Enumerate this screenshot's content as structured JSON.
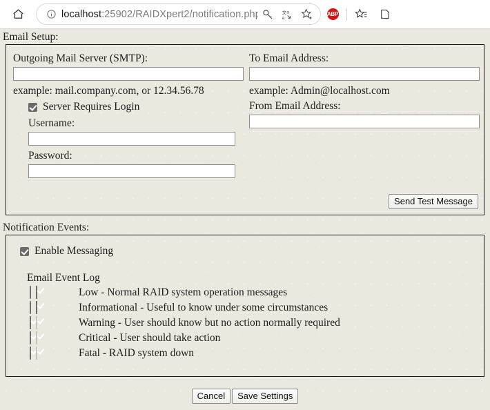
{
  "browser": {
    "home_icon": "home-icon",
    "info_icon": "info-circle-icon",
    "url_host": "localhost",
    "url_path": ":25902/RAIDXpert2/notification.php",
    "search_icon": "search-key-icon",
    "translate_icon": "translate-icon",
    "favorite_icon": "star-add-icon",
    "adblock_label": "ABP",
    "collections_icon": "favorites-list-icon",
    "overflow_icon": "partial-icon"
  },
  "email_setup": {
    "section_label": "Email Setup:",
    "smtp_label": "Outgoing Mail Server (SMTP):",
    "smtp_value": "",
    "smtp_hint": "example: mail.company.com, or 12.34.56.78",
    "requires_login_label": "Server Requires Login",
    "requires_login_checked": true,
    "username_label": "Username:",
    "username_value": "",
    "password_label": "Password:",
    "password_value": "",
    "to_email_label": "To Email Address:",
    "to_email_value": "",
    "to_email_hint": "example: Admin@localhost.com",
    "from_email_label": "From Email Address:",
    "from_email_value": "",
    "send_test_label": "Send Test Message"
  },
  "notification_events": {
    "section_label": "Notification Events:",
    "enable_messaging_label": "Enable Messaging",
    "enable_messaging_checked": true,
    "column_headers": "Email Event Log",
    "rows": [
      {
        "label": "Low - Normal RAID system operation messages",
        "email": "off",
        "eventlog": "on"
      },
      {
        "label": "Informational - Useful to know under some circumstances",
        "email": "off",
        "eventlog": "on"
      },
      {
        "label": "Warning - User should know but no action normally required",
        "email": "on",
        "eventlog": "on-dim"
      },
      {
        "label": "Critical - User should take action",
        "email": "on",
        "eventlog": "on-dim"
      },
      {
        "label": "Fatal - RAID system down",
        "email": "on",
        "eventlog": "on-dim"
      }
    ]
  },
  "footer": {
    "cancel_label": "Cancel",
    "save_label": "Save Settings"
  },
  "colors": {
    "page_bg": "#ebe9df",
    "border": "#1a1a1a",
    "checkbox_on": "#6b6b6b",
    "checkbox_on_dim": "#c3c3c3",
    "adblock_red": "#d71313"
  }
}
